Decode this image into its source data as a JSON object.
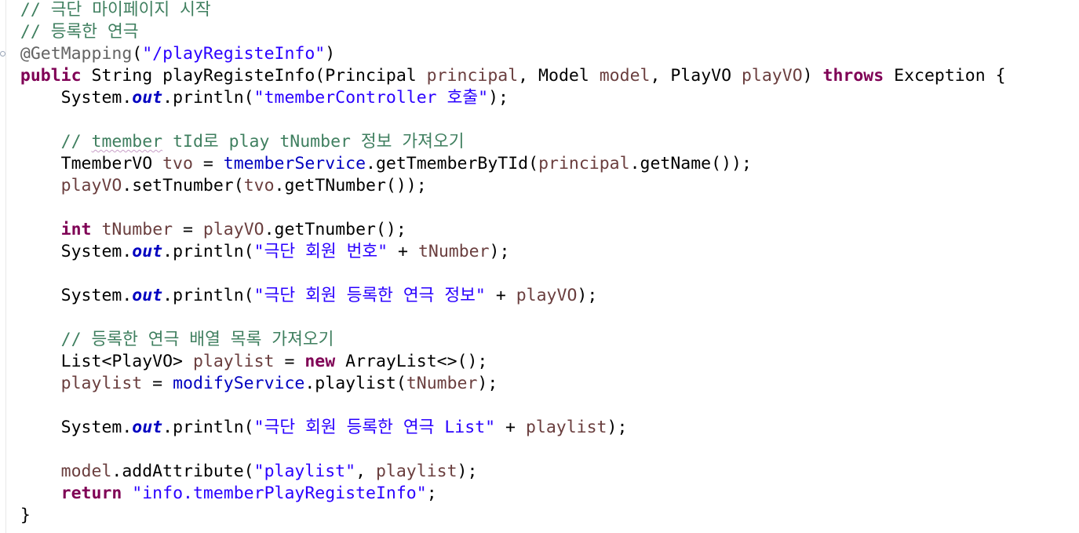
{
  "editor": {
    "language": "Java",
    "colors": {
      "background": "#ffffff",
      "comment": "#3f7f5f",
      "annotation": "#646464",
      "keyword": "#7f0055",
      "string": "#2a00ff",
      "field": "#0000c0",
      "local_variable": "#6a3e3e",
      "default": "#000000"
    },
    "lines": [
      {
        "tokens": [
          {
            "t": "  "
          },
          {
            "t": "// 극단 마이페이지 시작",
            "k": "comment"
          }
        ]
      },
      {
        "tokens": [
          {
            "t": "  "
          },
          {
            "t": "// 등록한 연극",
            "k": "comment"
          }
        ]
      },
      {
        "tokens": [
          {
            "t": "  "
          },
          {
            "t": "@GetMapping",
            "k": "annotation"
          },
          {
            "t": "("
          },
          {
            "t": "\"/playRegisteInfo\"",
            "k": "string"
          },
          {
            "t": ")"
          }
        ]
      },
      {
        "tokens": [
          {
            "t": "  "
          },
          {
            "t": "public",
            "k": "keyword"
          },
          {
            "t": " String playRegisteInfo(Principal "
          },
          {
            "t": "principal",
            "k": "local"
          },
          {
            "t": ", Model "
          },
          {
            "t": "model",
            "k": "local"
          },
          {
            "t": ", PlayVO "
          },
          {
            "t": "playVO",
            "k": "local"
          },
          {
            "t": ") "
          },
          {
            "t": "throws",
            "k": "keyword"
          },
          {
            "t": " Exception {"
          }
        ]
      },
      {
        "tokens": [
          {
            "t": "      System."
          },
          {
            "t": "out",
            "k": "static"
          },
          {
            "t": ".println("
          },
          {
            "t": "\"tmemberController 호출\"",
            "k": "string"
          },
          {
            "t": ");"
          }
        ]
      },
      {
        "tokens": [
          {
            "t": ""
          }
        ]
      },
      {
        "tokens": [
          {
            "t": "      "
          },
          {
            "t": "// ",
            "k": "comment"
          },
          {
            "t": "tmember",
            "k": "comment-warn"
          },
          {
            "t": " tId로 play tNumber 정보 가져오기",
            "k": "comment"
          }
        ]
      },
      {
        "tokens": [
          {
            "t": "      TmemberVO "
          },
          {
            "t": "tvo",
            "k": "local"
          },
          {
            "t": " = "
          },
          {
            "t": "tmemberService",
            "k": "field"
          },
          {
            "t": ".getTmemberByTId("
          },
          {
            "t": "principal",
            "k": "local"
          },
          {
            "t": ".getName());"
          }
        ]
      },
      {
        "tokens": [
          {
            "t": "      "
          },
          {
            "t": "playVO",
            "k": "local"
          },
          {
            "t": ".setTnumber("
          },
          {
            "t": "tvo",
            "k": "local"
          },
          {
            "t": ".getTNumber());"
          }
        ]
      },
      {
        "tokens": [
          {
            "t": ""
          }
        ]
      },
      {
        "tokens": [
          {
            "t": "      "
          },
          {
            "t": "int",
            "k": "keyword"
          },
          {
            "t": " "
          },
          {
            "t": "tNumber",
            "k": "local"
          },
          {
            "t": " = "
          },
          {
            "t": "playVO",
            "k": "local"
          },
          {
            "t": ".getTnumber();"
          }
        ]
      },
      {
        "tokens": [
          {
            "t": "      System."
          },
          {
            "t": "out",
            "k": "static"
          },
          {
            "t": ".println("
          },
          {
            "t": "\"극단 회원 번호\"",
            "k": "string"
          },
          {
            "t": " + "
          },
          {
            "t": "tNumber",
            "k": "local"
          },
          {
            "t": ");"
          }
        ]
      },
      {
        "tokens": [
          {
            "t": ""
          }
        ]
      },
      {
        "tokens": [
          {
            "t": "      System."
          },
          {
            "t": "out",
            "k": "static"
          },
          {
            "t": ".println("
          },
          {
            "t": "\"극단 회원 등록한 연극 정보\"",
            "k": "string"
          },
          {
            "t": " + "
          },
          {
            "t": "playVO",
            "k": "local"
          },
          {
            "t": ");"
          }
        ]
      },
      {
        "tokens": [
          {
            "t": ""
          }
        ]
      },
      {
        "tokens": [
          {
            "t": "      "
          },
          {
            "t": "// 등록한 연극 배열 목록 가져오기",
            "k": "comment"
          }
        ]
      },
      {
        "tokens": [
          {
            "t": "      List<PlayVO> "
          },
          {
            "t": "playlist",
            "k": "local"
          },
          {
            "t": " = "
          },
          {
            "t": "new",
            "k": "keyword"
          },
          {
            "t": " ArrayList<>();"
          }
        ]
      },
      {
        "tokens": [
          {
            "t": "      "
          },
          {
            "t": "playlist",
            "k": "local"
          },
          {
            "t": " = "
          },
          {
            "t": "modifyService",
            "k": "field"
          },
          {
            "t": ".playlist("
          },
          {
            "t": "tNumber",
            "k": "local"
          },
          {
            "t": ");"
          }
        ]
      },
      {
        "tokens": [
          {
            "t": ""
          }
        ]
      },
      {
        "tokens": [
          {
            "t": "      System."
          },
          {
            "t": "out",
            "k": "static"
          },
          {
            "t": ".println("
          },
          {
            "t": "\"극단 회원 등록한 연극 List\"",
            "k": "string"
          },
          {
            "t": " + "
          },
          {
            "t": "playlist",
            "k": "local"
          },
          {
            "t": ");"
          }
        ]
      },
      {
        "tokens": [
          {
            "t": ""
          }
        ]
      },
      {
        "tokens": [
          {
            "t": "      "
          },
          {
            "t": "model",
            "k": "local"
          },
          {
            "t": ".addAttribute("
          },
          {
            "t": "\"playlist\"",
            "k": "string"
          },
          {
            "t": ", "
          },
          {
            "t": "playlist",
            "k": "local"
          },
          {
            "t": ");"
          }
        ]
      },
      {
        "tokens": [
          {
            "t": "      "
          },
          {
            "t": "return",
            "k": "keyword"
          },
          {
            "t": " "
          },
          {
            "t": "\"info.tmemberPlayRegisteInfo\"",
            "k": "string"
          },
          {
            "t": ";"
          }
        ]
      },
      {
        "tokens": [
          {
            "t": "  }"
          }
        ]
      }
    ]
  }
}
